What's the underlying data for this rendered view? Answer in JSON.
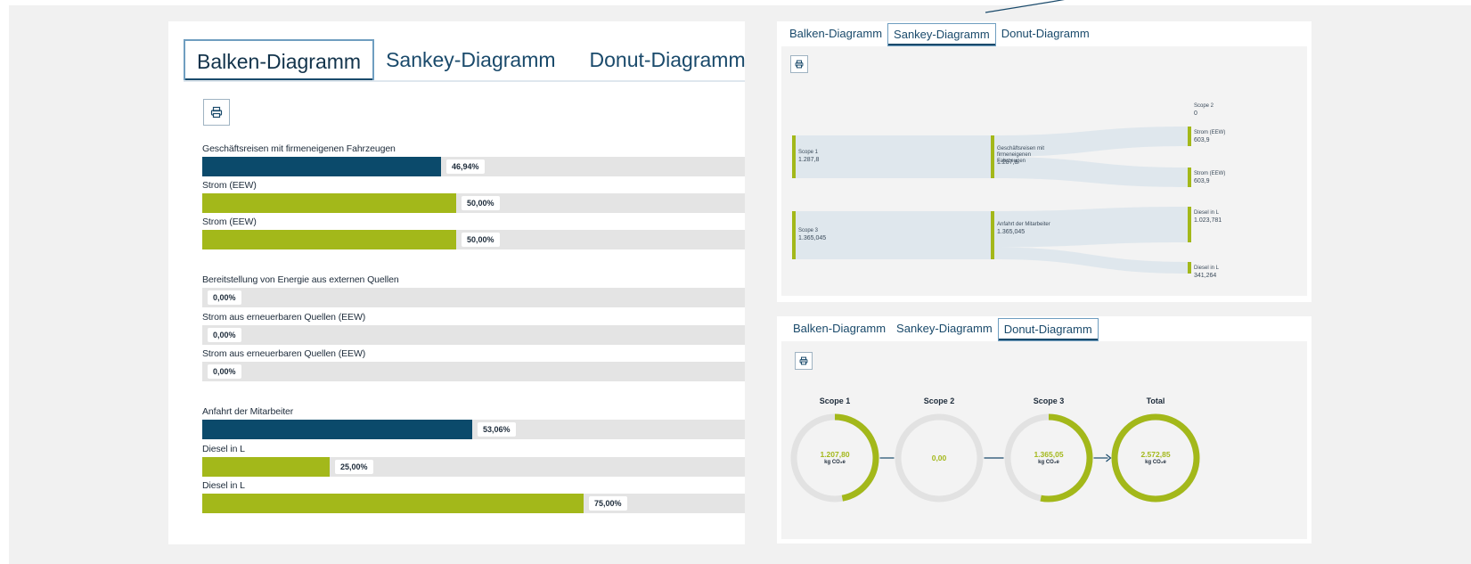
{
  "colors": {
    "navy": "#0b4a6b",
    "lime": "#a3b81a",
    "track": "#e4e4e4",
    "tab_text": "#1a4a6b",
    "tab_border": "#6f9ec0"
  },
  "icons": {
    "print": "printer-icon",
    "arrow": "arrow-right-icon"
  },
  "left_panel": {
    "tabs": [
      {
        "label": "Balken-Diagramm",
        "active": true
      },
      {
        "label": "Sankey-Diagramm",
        "active": false
      },
      {
        "label": "Donut-Diagramm",
        "active": false
      }
    ],
    "bars": [
      {
        "label": "Geschäftsreisen mit firmeneigenen Fahrzeugen",
        "percent": 46.94,
        "percent_text": "46,94%",
        "color": "navy"
      },
      {
        "label": "Strom (EEW)",
        "percent": 50,
        "percent_text": "50,00%",
        "color": "lime"
      },
      {
        "label": "Strom (EEW)",
        "percent": 50,
        "percent_text": "50,00%",
        "color": "lime"
      },
      {
        "label": "Bereitstellung von Energie aus externen Quellen",
        "percent": 0,
        "percent_text": "0,00%",
        "color": "navy"
      },
      {
        "label": "Strom aus erneuerbaren Quellen (EEW)",
        "percent": 0,
        "percent_text": "0,00%",
        "color": "lime"
      },
      {
        "label": "Strom aus erneuerbaren Quellen (EEW)",
        "percent": 0,
        "percent_text": "0,00%",
        "color": "lime"
      },
      {
        "label": "Anfahrt der Mitarbeiter",
        "percent": 53.06,
        "percent_text": "53,06%",
        "color": "navy"
      },
      {
        "label": "Diesel in L",
        "percent": 25,
        "percent_text": "25,00%",
        "color": "lime"
      },
      {
        "label": "Diesel in L",
        "percent": 75,
        "percent_text": "75,00%",
        "color": "lime"
      }
    ]
  },
  "sankey_panel": {
    "tabs": [
      {
        "label": "Balken-Diagramm",
        "active": false
      },
      {
        "label": "Sankey-Diagramm",
        "active": true
      },
      {
        "label": "Donut-Diagramm",
        "active": false
      }
    ],
    "nodes": [
      {
        "id": "scope1",
        "label": "Scope 1",
        "value": "1.287,8"
      },
      {
        "id": "scope3",
        "label": "Scope 3",
        "value": "1.365,045"
      },
      {
        "id": "geschaeft",
        "label": "Geschäftsreisen mit firmeneigenen Fahrzeugen",
        "value": "1.287,8"
      },
      {
        "id": "anfahrt",
        "label": "Anfahrt der Mitarbeiter",
        "value": "1.365,045"
      },
      {
        "id": "scope2",
        "label": "Scope 2",
        "value": "0"
      },
      {
        "id": "strom1",
        "label": "Strom (EEW)",
        "value": "603,9"
      },
      {
        "id": "strom2",
        "label": "Strom (EEW)",
        "value": "603,9"
      },
      {
        "id": "diesel1",
        "label": "Diesel in L",
        "value": "1.023,781"
      },
      {
        "id": "diesel2",
        "label": "Diesel in L",
        "value": "341,264"
      }
    ],
    "links": [
      {
        "source": "scope1",
        "target": "geschaeft",
        "value": 1287.8
      },
      {
        "source": "scope3",
        "target": "anfahrt",
        "value": 1365.045
      },
      {
        "source": "geschaeft",
        "target": "strom1",
        "value": 603.9
      },
      {
        "source": "geschaeft",
        "target": "strom2",
        "value": 603.9
      },
      {
        "source": "anfahrt",
        "target": "diesel1",
        "value": 1023.781
      },
      {
        "source": "anfahrt",
        "target": "diesel2",
        "value": 341.264
      }
    ]
  },
  "donut_panel": {
    "tabs": [
      {
        "label": "Balken-Diagramm",
        "active": false
      },
      {
        "label": "Sankey-Diagramm",
        "active": false
      },
      {
        "label": "Donut-Diagramm",
        "active": true
      }
    ],
    "donuts": [
      {
        "title": "Scope 1",
        "value": "1.207,80",
        "unit": "kg CO₂e",
        "fraction": 0.47
      },
      {
        "title": "Scope 2",
        "value": "0,00",
        "unit": "",
        "fraction": 0
      },
      {
        "title": "Scope 3",
        "value": "1.365,05",
        "unit": "kg CO₂e",
        "fraction": 0.53
      },
      {
        "title": "Total",
        "value": "2.572,85",
        "unit": "kg CO₂e",
        "fraction": 1
      }
    ]
  }
}
